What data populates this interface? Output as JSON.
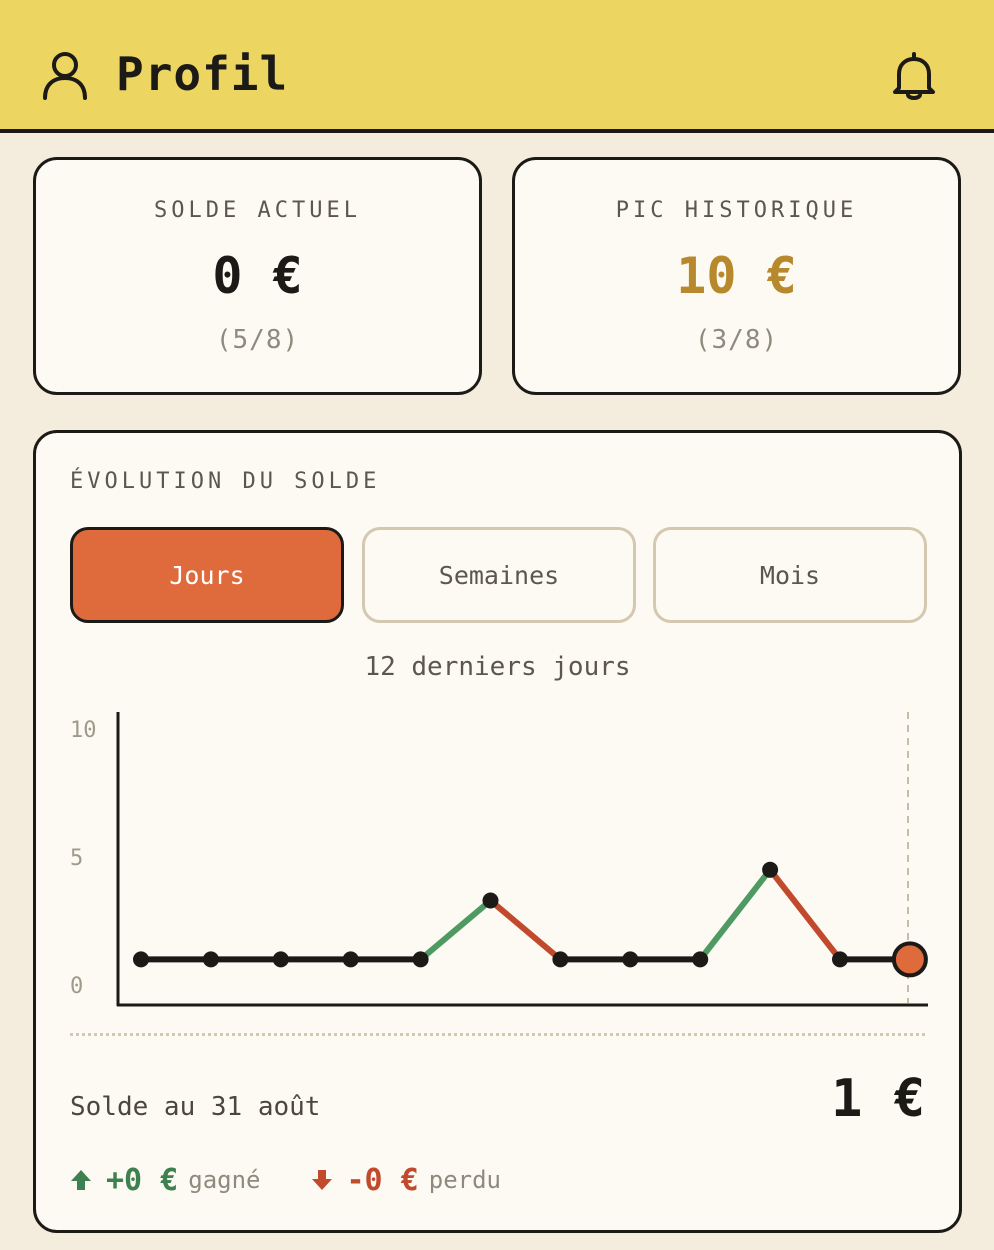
{
  "header": {
    "title": "Profil"
  },
  "stats": [
    {
      "label": "SOLDE ACTUEL",
      "value": "0 €",
      "sub": "(5/8)"
    },
    {
      "label": "PIC HISTORIQUE",
      "value": "10 €",
      "sub": "(3/8)"
    }
  ],
  "evolution": {
    "title": "ÉVOLUTION DU SOLDE",
    "tabs": [
      "Jours",
      "Semaines",
      "Mois"
    ],
    "active_tab": "Jours",
    "range_label": "12 derniers jours",
    "balance_label": "Solde au 31 août",
    "balance_value": "1 €",
    "gained_amount": "+0 €",
    "gained_word": "gagné",
    "lost_amount": "-0 €",
    "lost_word": "perdu"
  },
  "colors": {
    "header_bg": "#edd561",
    "accent": "#df6b3c",
    "gold": "#b8892c",
    "up": "#4f9a63",
    "down": "#c24a2c",
    "line": "#1c1a17"
  },
  "chart_data": {
    "type": "line",
    "x": [
      1,
      2,
      3,
      4,
      5,
      6,
      7,
      8,
      9,
      10,
      11,
      12
    ],
    "values": [
      1,
      1,
      1,
      1,
      1,
      3.3,
      1,
      1,
      1,
      4.5,
      1,
      1
    ],
    "yticks": [
      "10",
      "5",
      "0"
    ],
    "ylim": [
      0,
      10
    ],
    "grid": false
  }
}
